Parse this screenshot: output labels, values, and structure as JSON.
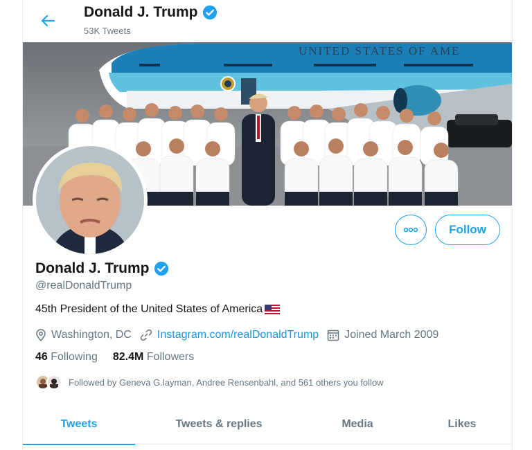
{
  "header": {
    "name": "Donald J. Trump",
    "tweet_count": "53K Tweets"
  },
  "banner": {
    "plane_text": "UNITED STATES OF AME"
  },
  "actions": {
    "follow_label": "Follow"
  },
  "profile": {
    "name": "Donald J. Trump",
    "handle": "@realDonaldTrump",
    "bio": "45th President of the United States of America",
    "location": "Washington, DC",
    "website": "Instagram.com/realDonaldTrump",
    "joined": "Joined March 2009"
  },
  "stats": {
    "following_count": "46",
    "following_label": "Following",
    "followers_count": "82.4M",
    "followers_label": "Followers"
  },
  "followed_by": "Followed by Geneva G.layman, Andree Rensenbahl, and 561 others you follow",
  "tabs": [
    {
      "label": "Tweets"
    },
    {
      "label": "Tweets & replies"
    },
    {
      "label": "Media"
    },
    {
      "label": "Likes"
    }
  ],
  "colors": {
    "accent": "#1da1f2",
    "link": "#1b95e0",
    "secondary_text": "#657786",
    "primary_text": "#14171a"
  },
  "icons": [
    "back-arrow-icon",
    "verified-badge-icon",
    "more-options-icon",
    "location-pin-icon",
    "link-icon",
    "calendar-icon",
    "us-flag-icon"
  ]
}
